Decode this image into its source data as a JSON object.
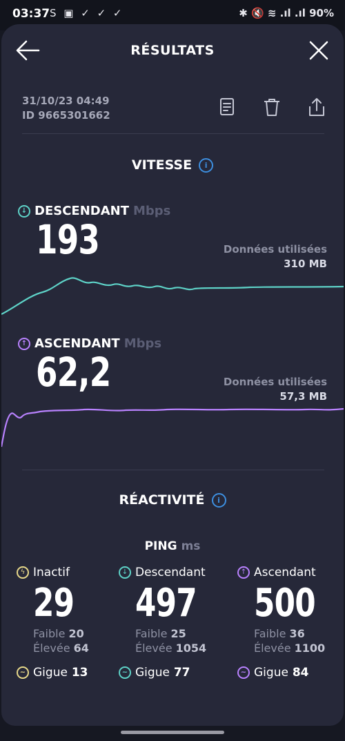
{
  "status_bar": {
    "time": "03:37",
    "left_icons": "S ▣ ✓ ✓ ✓",
    "right_icons": "✱ 🔇 ≋ .ıl .ıl",
    "battery": "90%"
  },
  "header": {
    "title": "RÉSULTATS"
  },
  "meta": {
    "datetime": "31/10/23 04:49",
    "id": "ID 9665301662"
  },
  "sections": {
    "speed_title": "VITESSE",
    "reactivity_title": "RÉACTIVITÉ",
    "info_glyph": "i"
  },
  "download": {
    "label": "DESCENDANT",
    "unit": "Mbps",
    "value": "193",
    "data_used_label": "Données utilisées",
    "data_used_value": "310 MB",
    "color": "#5ed3c8"
  },
  "upload": {
    "label": "ASCENDANT",
    "unit": "Mbps",
    "value": "62,2",
    "data_used_label": "Données utilisées",
    "data_used_value": "57,3 MB",
    "color": "#b982ff"
  },
  "ping": {
    "title": "PING",
    "unit": "ms",
    "idle": {
      "label": "Inactif",
      "value": "29",
      "low_label": "Faible",
      "low": "20",
      "high_label": "Élevée",
      "high": "64",
      "jitter_label": "Gigue",
      "jitter": "13",
      "color": "#e8d98a"
    },
    "down": {
      "label": "Descendant",
      "value": "497",
      "low_label": "Faible",
      "low": "25",
      "high_label": "Élevée",
      "high": "1054",
      "jitter_label": "Gigue",
      "jitter": "77",
      "color": "#5ed3c8"
    },
    "up": {
      "label": "Ascendant",
      "value": "500",
      "low_label": "Faible",
      "low": "36",
      "high_label": "Élevée",
      "high": "1100",
      "jitter_label": "Gigue",
      "jitter": "84",
      "color": "#b982ff"
    }
  },
  "icons": {
    "back": "arrow-left-icon",
    "close": "close-icon",
    "report": "document-icon",
    "delete": "trash-icon",
    "share": "share-icon"
  }
}
